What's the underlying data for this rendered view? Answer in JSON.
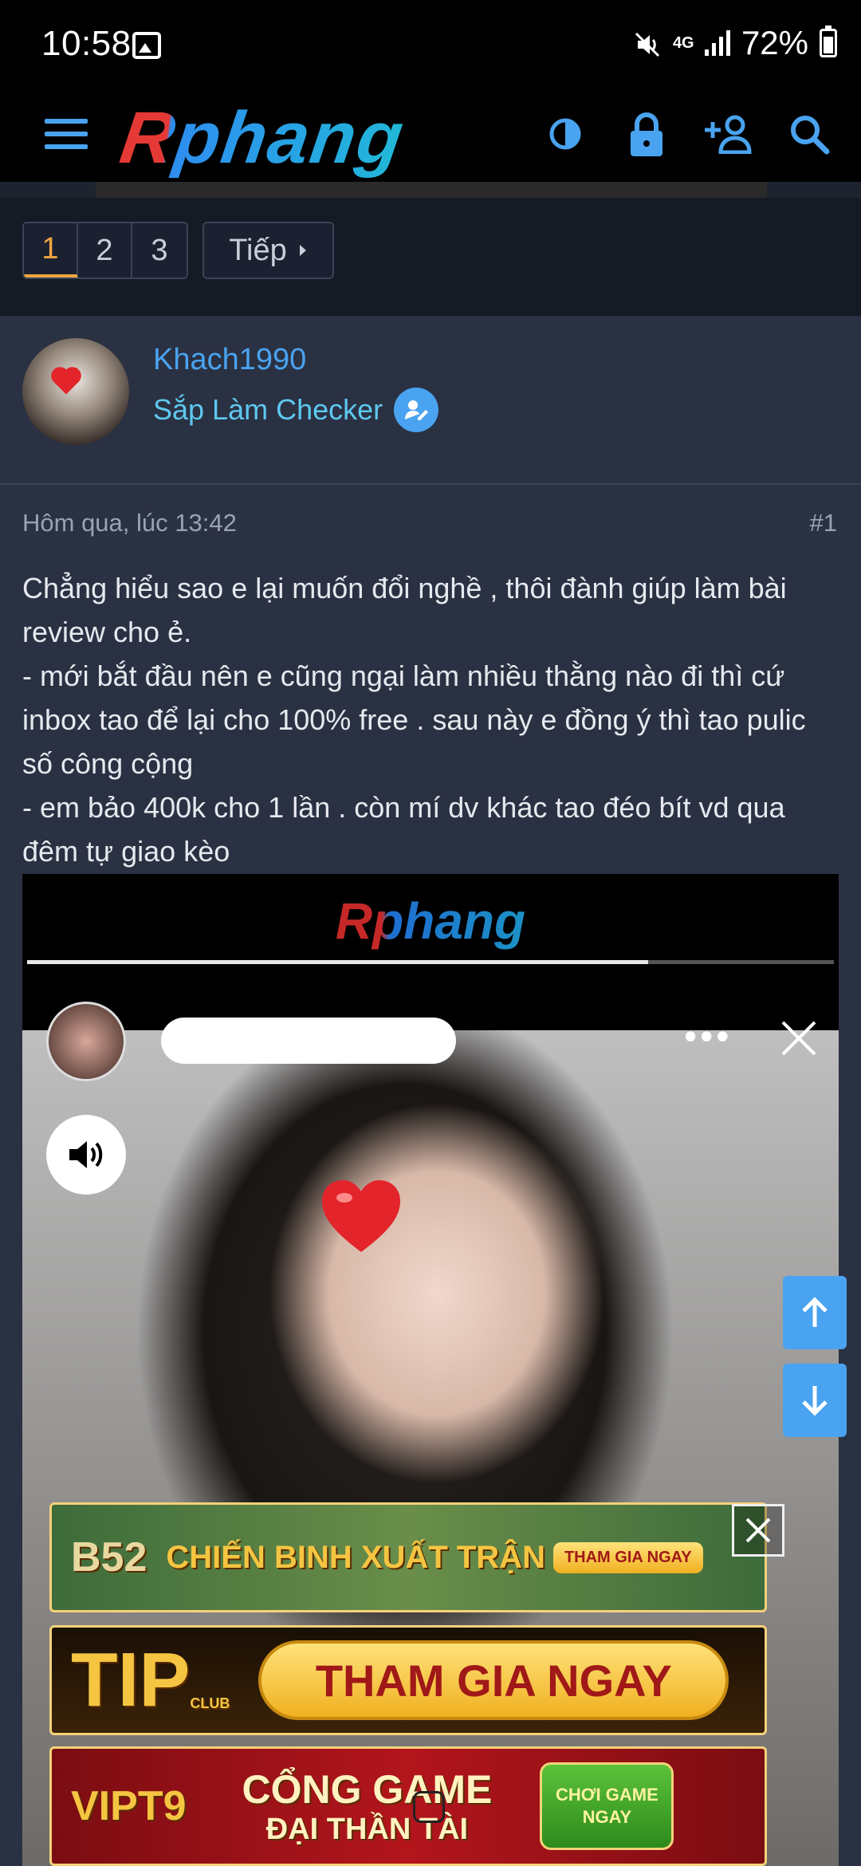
{
  "status_bar": {
    "time": "10:58",
    "network": "4G",
    "battery": "72%"
  },
  "header": {
    "logo": "Rphang"
  },
  "pagination": {
    "pages": [
      "1",
      "2",
      "3"
    ],
    "active_page": "1",
    "next_label": "Tiếp"
  },
  "user": {
    "name": "Khach1990",
    "title": "Sắp Làm Checker"
  },
  "post": {
    "timestamp": "Hôm qua, lúc 13:42",
    "number": "#1",
    "body_lines": [
      "Chẳng hiểu sao e lại muốn đổi nghề , thôi đành giúp làm bài review cho ẻ.",
      "- mới bắt đầu nên e cũng ngại làm nhiều thằng nào đi thì cứ inbox tao để lại cho 100% free . sau này e đồng ý thì tao pulic số công cộng",
      "- em bảo 400k cho 1 lần . còn mí dv khác tao đéo bít vd qua đêm tự giao kèo"
    ]
  },
  "embedded_image": {
    "watermark": "Rphang",
    "story_progress": 0.77
  },
  "ads": [
    {
      "brand": "B52",
      "text": "CHIẾN BINH XUẤT TRẬN",
      "cta": "THAM GIA NGAY"
    },
    {
      "brand": "TIP",
      "sub": "CLUB",
      "cta": "THAM GIA NGAY"
    },
    {
      "brand": "VIPT9",
      "text_line1": "CỔNG GAME",
      "text_line2": "ĐẠI THẦN TÀI",
      "cta": "CHƠI GAME NGAY"
    }
  ],
  "colors": {
    "accent": "#4aa3f0",
    "page_bg": "#2a3142",
    "active_page": "#f2a640"
  }
}
